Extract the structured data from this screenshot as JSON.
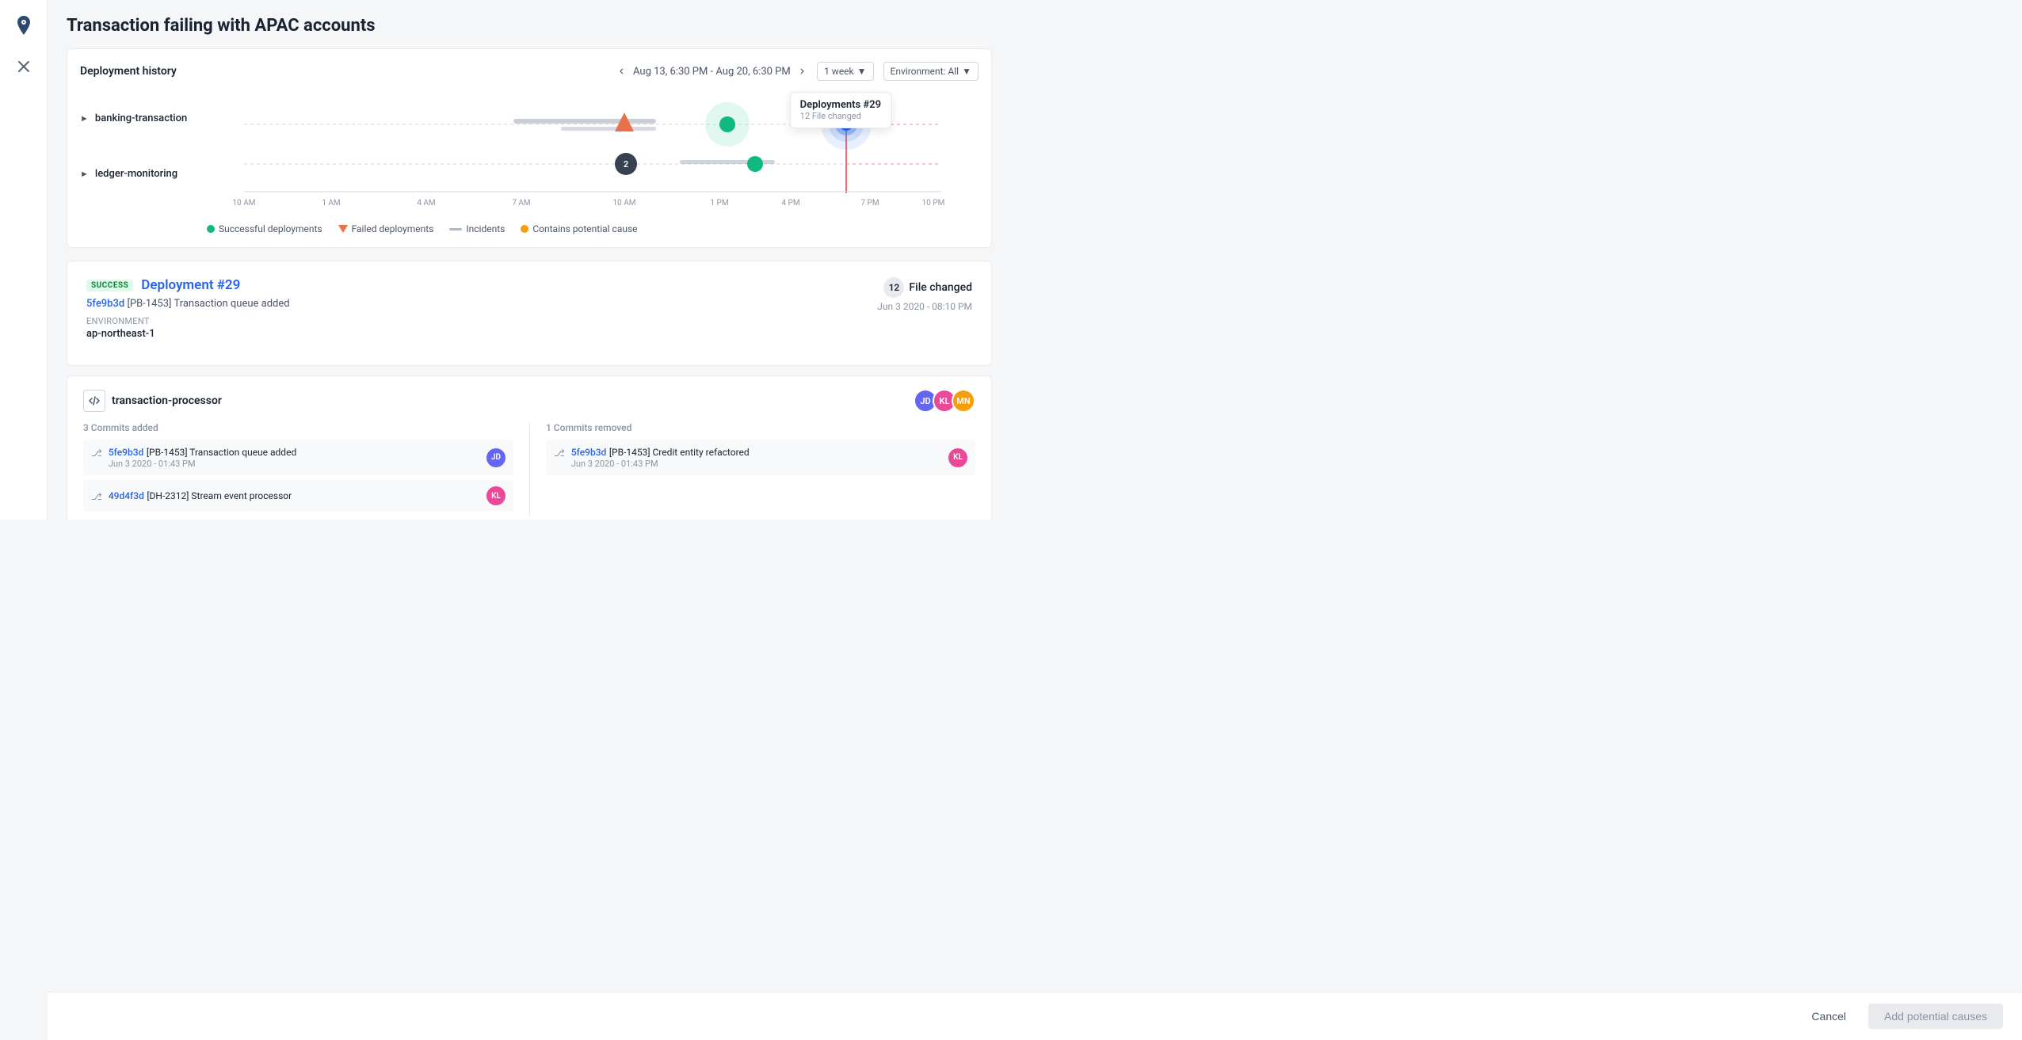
{
  "page": {
    "title": "Transaction failing with APAC accounts"
  },
  "sidebar": {
    "icons": [
      "location-pin-icon",
      "close-icon"
    ]
  },
  "deployment_history": {
    "title": "Deployment history",
    "date_range": "Aug 13, 6:30 PM - Aug 20, 6:30 PM",
    "time_window": "1 week",
    "environment": "Environment: All",
    "services": [
      {
        "name": "banking-transaction"
      },
      {
        "name": "ledger-monitoring"
      }
    ],
    "time_labels": [
      "10 AM",
      "1 AM",
      "4 AM",
      "7 AM",
      "10 AM",
      "1 PM",
      "4 PM",
      "7 PM",
      "10 PM"
    ],
    "legend": {
      "successful": "Successful deployments",
      "failed": "Failed deployments",
      "incidents": "Incidents",
      "potential_cause": "Contains potential cause"
    }
  },
  "tooltip": {
    "title": "Deployments #29",
    "subtitle": "12 File changed"
  },
  "deployment_detail": {
    "status": "SUCCESS",
    "name": "Deployment #29",
    "commit_hash": "5fe9b3d",
    "commit_message": "[PB-1453] Transaction queue added",
    "environment_label": "Environment",
    "environment_value": "ap-northeast-1",
    "file_count": "12",
    "file_changed_label": "File changed",
    "date": "Jun 3 2020 - 08:10 PM"
  },
  "service_section": {
    "name": "transaction-processor",
    "commits_added_label": "3 Commits added",
    "commits_removed_label": "1 Commits removed",
    "commits_added": [
      {
        "hash": "5fe9b3d",
        "message": "[PB-1453] Transaction queue added",
        "date": "Jun 3 2020 - 01:43 PM"
      },
      {
        "hash": "49d4f3d",
        "message": "[DH-2312] Stream event processor",
        "date": ""
      }
    ],
    "commits_removed": [
      {
        "hash": "5fe9b3d",
        "message": "[PB-1453] Credit entity refactored",
        "date": "Jun 3 2020 - 01:43 PM"
      }
    ]
  },
  "footer": {
    "cancel_label": "Cancel",
    "add_causes_label": "Add potential causes"
  }
}
